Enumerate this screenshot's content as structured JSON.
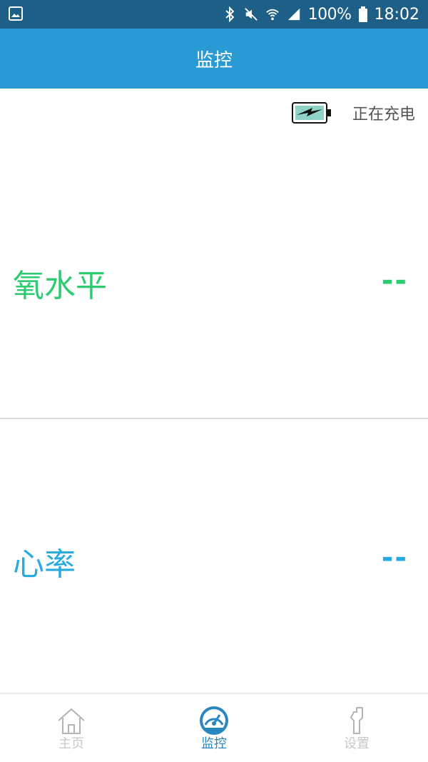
{
  "status_bar": {
    "battery_percent": "100%",
    "time": "18:02",
    "background_color": "#1e5f87"
  },
  "app_bar": {
    "title": "监控",
    "background_color": "#2a9ad4"
  },
  "charging": {
    "status_text": "正在充电",
    "icon": "battery-charging-icon"
  },
  "metrics": [
    {
      "label": "氧水平",
      "value": "--",
      "color": "#2ecc71"
    },
    {
      "label": "心率",
      "value": "--",
      "color": "#29abe2"
    }
  ],
  "tabs": [
    {
      "label": "主页",
      "icon": "home-icon",
      "active": false,
      "color": "#c8c8c8"
    },
    {
      "label": "监控",
      "icon": "gauge-icon",
      "active": true,
      "color": "#2a86c1"
    },
    {
      "label": "设置",
      "icon": "wrench-icon",
      "active": false,
      "color": "#c8c8c8"
    }
  ]
}
